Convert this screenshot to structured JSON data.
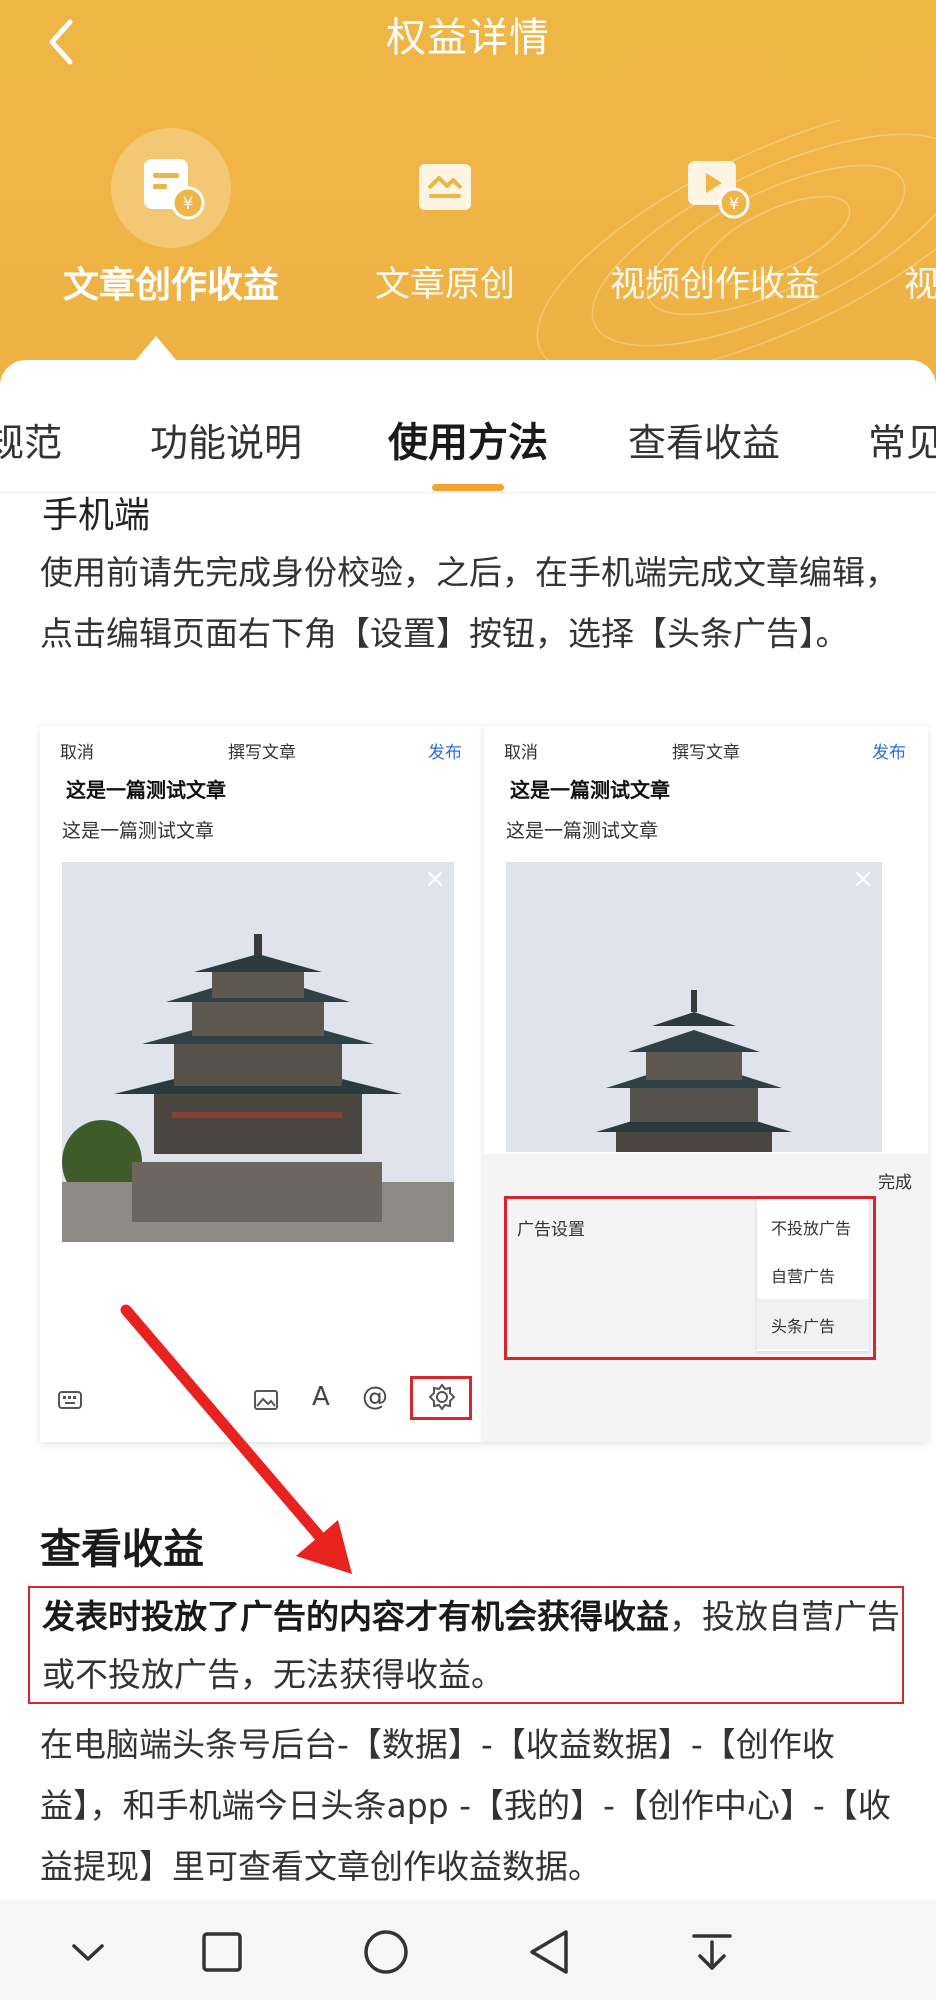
{
  "header": {
    "title": "权益详情",
    "benefits": [
      {
        "label": "文章创作收益",
        "icon": "article-income-icon"
      },
      {
        "label": "文章原创",
        "icon": "article-original-icon"
      },
      {
        "label": "视频创作收益",
        "icon": "video-income-icon"
      },
      {
        "label": "视",
        "icon": ""
      }
    ]
  },
  "tabs": [
    "规范",
    "功能说明",
    "使用方法",
    "查看收益",
    "常见"
  ],
  "active_tab": "使用方法",
  "usage": {
    "sub_heading": "手机端",
    "paragraph": "使用前请先完成身份校验，之后，在手机端完成文章编辑，点击编辑页面右下角【设置】按钮，选择【头条广告】。"
  },
  "illustration": {
    "left_phone": {
      "cancel": "取消",
      "compose": "撰写文章",
      "publish": "发布",
      "article_title": "这是一篇测试文章",
      "article_body": "这是一篇测试文章"
    },
    "right_phone": {
      "cancel": "取消",
      "compose": "撰写文章",
      "publish": "发布",
      "article_title": "这是一篇测试文章",
      "article_body": "这是一篇测试文章",
      "done": "完成",
      "ad_settings": "广告设置",
      "ad_options": [
        "不投放广告",
        "自营广告",
        "头条广告"
      ]
    }
  },
  "earnings": {
    "title": "查看收益",
    "highlight_bold": "发表时投放了广告的内容才有机会获得收益",
    "highlight_rest": "，投放自营广告或不投放广告，无法获得收益。",
    "paragraph": "在电脑端头条号后台-【数据】-【收益数据】-【创作收益】，和手机端今日头条app -【我的】-【创作中心】-【收益提现】里可查看文章创作收益数据。"
  },
  "colors": {
    "header_gradient": "#efb545",
    "accent_underline": "#f0a42c",
    "annotation_red": "#d9262c",
    "publish_blue": "#2b6fd6"
  },
  "navbar": [
    "chevron-down-icon",
    "square-icon",
    "circle-icon",
    "triangle-back-icon",
    "download-notification-icon"
  ]
}
